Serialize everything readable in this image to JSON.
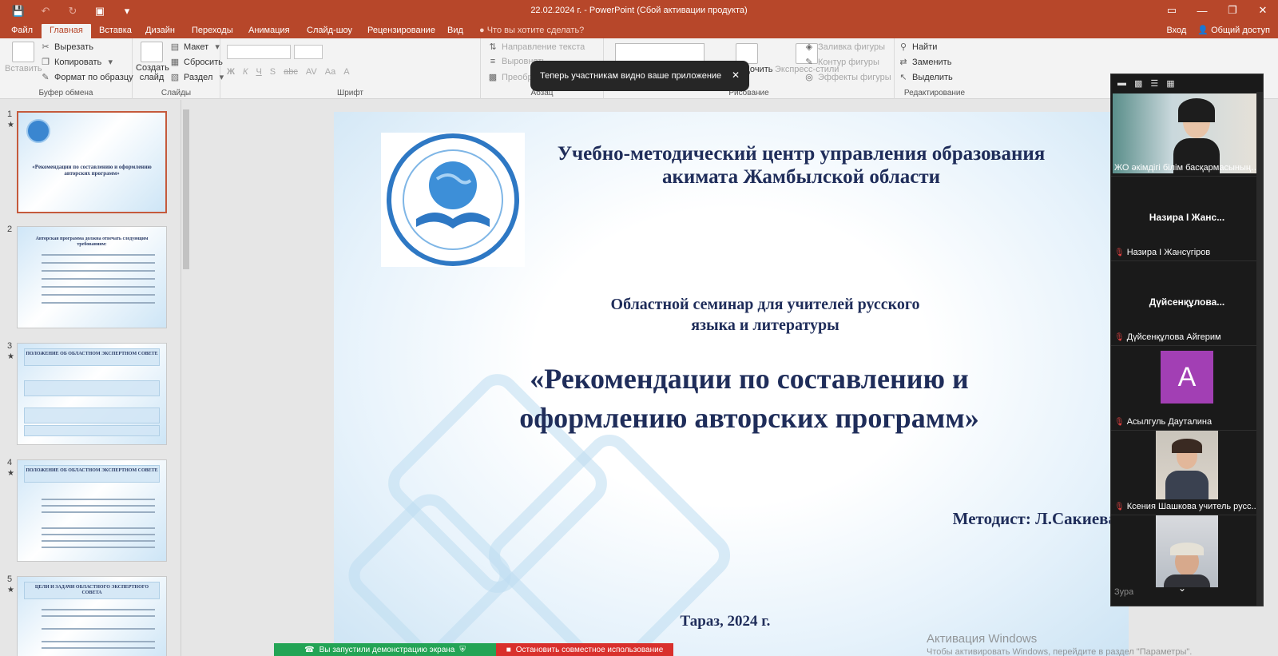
{
  "titlebar": {
    "title": "22.02.2024 г. - PowerPoint (Сбой активации продукта)",
    "window_buttons": [
      "▭",
      "—",
      "❐",
      "✕"
    ]
  },
  "tabs": {
    "items": [
      "Файл",
      "Главная",
      "Вставка",
      "Дизайн",
      "Переходы",
      "Анимация",
      "Слайд-шоу",
      "Рецензирование",
      "Вид"
    ],
    "active": "Главная",
    "tell_me": "Что вы хотите сделать?",
    "signin": "Вход",
    "share": "Общий доступ"
  },
  "ribbon": {
    "clipboard": {
      "paste": "Вставить",
      "cut": "Вырезать",
      "copy": "Копировать",
      "format_painter": "Формат по образцу",
      "name": "Буфер обмена"
    },
    "slides": {
      "new_slide": "Создать слайд",
      "layout": "Макет",
      "reset": "Сбросить",
      "section": "Раздел",
      "name": "Слайды"
    },
    "font": {
      "name": "Шрифт",
      "styles": [
        "Ж",
        "К",
        "Ч",
        "S",
        "abc",
        "AV",
        "Aa",
        "A"
      ]
    },
    "paragraph": {
      "text_direction": "Направление текста",
      "align_text": "Выровнять",
      "convert": "Преобр",
      "name": "Абзац"
    },
    "drawing": {
      "arrange": "Упорядочить",
      "quick_styles": "Экспресс-стили",
      "fill": "Заливка фигуры",
      "outline": "Контур фигуры",
      "effects": "Эффекты фигуры",
      "name": "Рисование"
    },
    "editing": {
      "find": "Найти",
      "replace": "Заменить",
      "select": "Выделить",
      "name": "Редактирование"
    }
  },
  "toast": {
    "text": "Теперь участникам видно ваше приложение",
    "close": "✕"
  },
  "thumbnails": [
    {
      "num": "1",
      "star": "★",
      "title": "«Рекомендации по составлению и оформлению авторских программ»"
    },
    {
      "num": "2",
      "star": "",
      "title": "Авторская программа должна отвечать следующим требованиям:"
    },
    {
      "num": "3",
      "star": "★",
      "title": "ПОЛОЖЕНИЕ ОБ ОБЛАСТНОМ ЭКСПЕРТНОМ СОВЕТЕ"
    },
    {
      "num": "4",
      "star": "★",
      "title": "ПОЛОЖЕНИЕ ОБ ОБЛАСТНОМ ЭКСПЕРТНОМ СОВЕТЕ"
    },
    {
      "num": "5",
      "star": "★",
      "title": "ЦЕЛИ И ЗАДАЧИ ОБЛАСТНОГО ЭКСПЕРТНОГО СОВЕТА"
    }
  ],
  "slide": {
    "org_line1": "Учебно-методический центр управления образования",
    "org_line2": "акимата Жамбылской области",
    "seminar_line1": "Областной семинар для учителей русского",
    "seminar_line2": "языка и литературы",
    "title_line1": "«Рекомендации по составлению и",
    "title_line2": "оформлению авторских программ»",
    "author": "Методист: Л.Сакиева",
    "place": "Тараз, 2024 г."
  },
  "participants": [
    {
      "label": "ЖО әкімдігі білім басқармасының ...",
      "big": "",
      "video": true
    },
    {
      "label": "Назира  І Жансүгіров",
      "big": "Назира  І Жанс...",
      "video": false
    },
    {
      "label": "Дүйсенқұлова Айгерим",
      "big": "Дүйсенқұлова...",
      "video": false
    },
    {
      "label": "Асылгуль Дауталина",
      "big": "A",
      "video": false
    },
    {
      "label": "Ксения Шашкова учитель русс...",
      "big": "",
      "video": true
    },
    {
      "label": "Зура",
      "big": "",
      "video": true
    }
  ],
  "sharebar": {
    "running": "Вы запустили демонстрацию экрана",
    "stop": "Остановить совместное использование"
  },
  "watermark": {
    "line1": "Активация Windows",
    "line2": "Чтобы активировать Windows, перейдите в раздел \"Параметры\"."
  }
}
